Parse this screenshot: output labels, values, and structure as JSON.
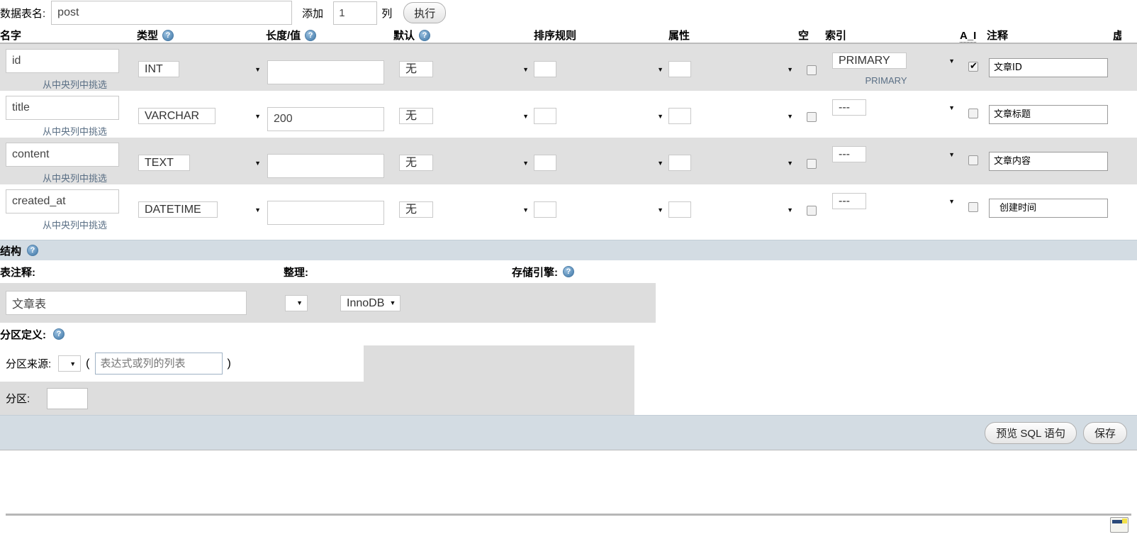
{
  "top": {
    "table_name_label": "数据表名:",
    "table_name_value": "post",
    "add_label": "添加",
    "add_count": "1",
    "columns_label": "列",
    "go_button": "执行"
  },
  "headers": {
    "name": "名字",
    "type": "类型",
    "length": "长度/值",
    "default": "默认",
    "collation": "排序规则",
    "attributes": "属性",
    "null": "空",
    "index": "索引",
    "auto_increment": "A_I",
    "comment": "注释",
    "virtuality": "虚"
  },
  "pick_from_central_label": "从中央列中挑选",
  "columns": [
    {
      "name": "id",
      "type": "INT",
      "length": "",
      "default": "无",
      "collation": "",
      "attributes": "",
      "null_checked": false,
      "index": "PRIMARY",
      "index_sub": "PRIMARY",
      "ai_checked": true,
      "comment": "文章ID"
    },
    {
      "name": "title",
      "type": "VARCHAR",
      "length": "200",
      "default": "无",
      "collation": "",
      "attributes": "",
      "null_checked": false,
      "index": "---",
      "index_sub": "",
      "ai_checked": false,
      "comment": "文章标题"
    },
    {
      "name": "content",
      "type": "TEXT",
      "length": "",
      "default": "无",
      "collation": "",
      "attributes": "",
      "null_checked": false,
      "index": "---",
      "index_sub": "",
      "ai_checked": false,
      "comment": "文章内容"
    },
    {
      "name": "created_at",
      "type": "DATETIME",
      "length": "",
      "default": "无",
      "collation": "",
      "attributes": "",
      "null_checked": false,
      "index": "---",
      "index_sub": "",
      "ai_checked": false,
      "comment": "创建时间"
    }
  ],
  "structure": {
    "section_title": "结构",
    "table_comment_label": "表注释:",
    "table_comment_value": "文章表",
    "collation_label": "整理:",
    "collation_value": "",
    "engine_label": "存储引擎:",
    "engine_value": "InnoDB"
  },
  "partition": {
    "title": "分区定义:",
    "source_label": "分区来源:",
    "source_value": "",
    "expression_placeholder": "表达式或列的列表",
    "paren_open": "(",
    "paren_close": ")",
    "partitions_label": "分区:",
    "partitions_value": ""
  },
  "footer": {
    "preview_sql": "预览 SQL 语句",
    "save": "保存"
  },
  "colors": {
    "alt_row": "#e0e0e0",
    "section_bar": "#d3dce3",
    "link": "#5a6f85",
    "panel_gray": "#dddddd"
  }
}
